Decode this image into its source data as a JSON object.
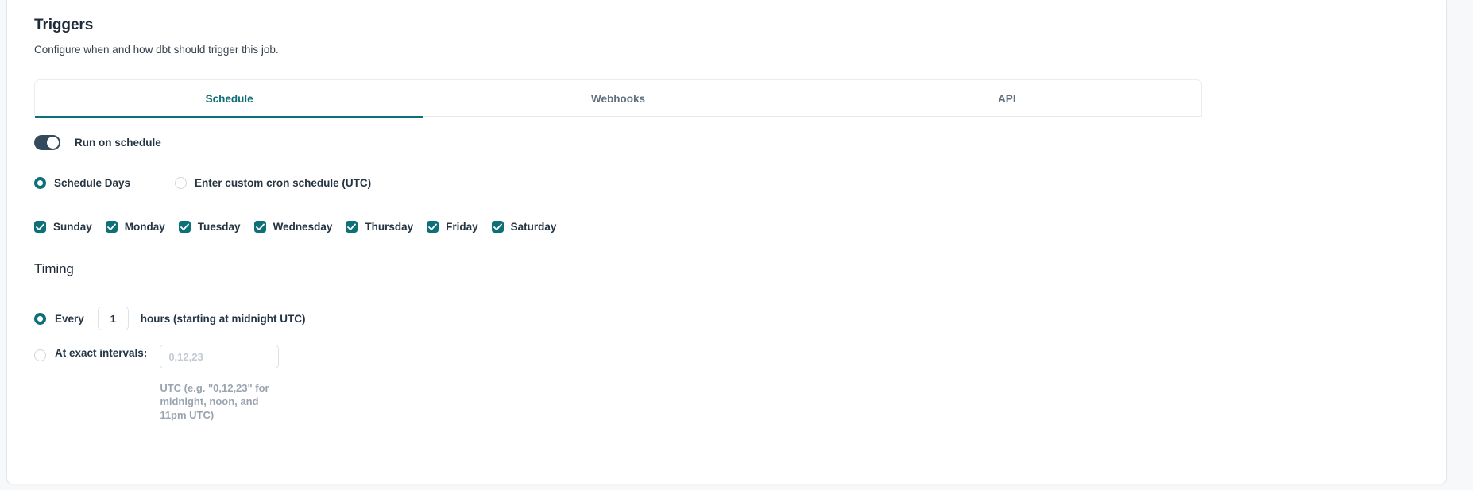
{
  "section": {
    "title": "Triggers",
    "description": "Configure when and how dbt should trigger this job."
  },
  "tabs": [
    {
      "label": "Schedule",
      "active": true
    },
    {
      "label": "Webhooks",
      "active": false
    },
    {
      "label": "API",
      "active": false
    }
  ],
  "run_on_schedule": {
    "label": "Run on schedule",
    "enabled": true
  },
  "schedule_mode": {
    "options": [
      {
        "label": "Schedule Days",
        "selected": true
      },
      {
        "label": "Enter custom cron schedule (UTC)",
        "selected": false
      }
    ]
  },
  "days": [
    {
      "label": "Sunday",
      "checked": true
    },
    {
      "label": "Monday",
      "checked": true
    },
    {
      "label": "Tuesday",
      "checked": true
    },
    {
      "label": "Wednesday",
      "checked": true
    },
    {
      "label": "Thursday",
      "checked": true
    },
    {
      "label": "Friday",
      "checked": true
    },
    {
      "label": "Saturday",
      "checked": true
    }
  ],
  "timing": {
    "title": "Timing",
    "every": {
      "label": "Every",
      "selected": true,
      "value": "1",
      "suffix": "hours (starting at midnight UTC)"
    },
    "exact": {
      "label": "At exact intervals:",
      "selected": false,
      "value": "",
      "placeholder": "0,12,23",
      "helper": "UTC (e.g. \"0,12,23\" for midnight, noon, and 11pm UTC)"
    }
  },
  "colors": {
    "accent_teal": "#0d7078",
    "toggle_on": "#33495c",
    "text_primary": "#263543",
    "muted": "#9aa4b0"
  }
}
